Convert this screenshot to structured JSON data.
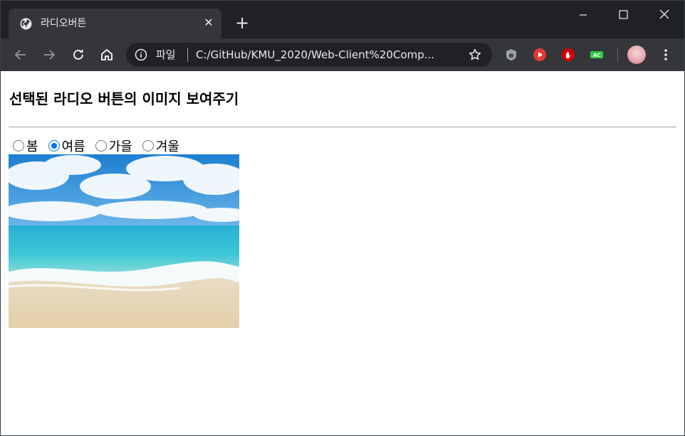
{
  "browser": {
    "tab_title": "라디오버튼",
    "tab_close": "✕",
    "new_tab": "+",
    "address_scheme": "파일",
    "address_url": "C:/GitHub/KMU_2020/Web-Client%20Comp..."
  },
  "page": {
    "heading": "선택된 라디오 버튼의 이미지 보여주기",
    "options": [
      {
        "label": "봄",
        "checked": false
      },
      {
        "label": "여름",
        "checked": true
      },
      {
        "label": "가을",
        "checked": false
      },
      {
        "label": "겨울",
        "checked": false
      }
    ]
  },
  "colors": {
    "tabstrip": "#202124",
    "toolbar": "#35363a",
    "radio_accent": "#0075ff"
  },
  "icons": {
    "favicon": "globe-icon",
    "back": "back-arrow-icon",
    "forward": "forward-arrow-icon",
    "reload": "reload-icon",
    "home": "home-icon",
    "info": "info-icon",
    "bookmark": "star-icon"
  }
}
